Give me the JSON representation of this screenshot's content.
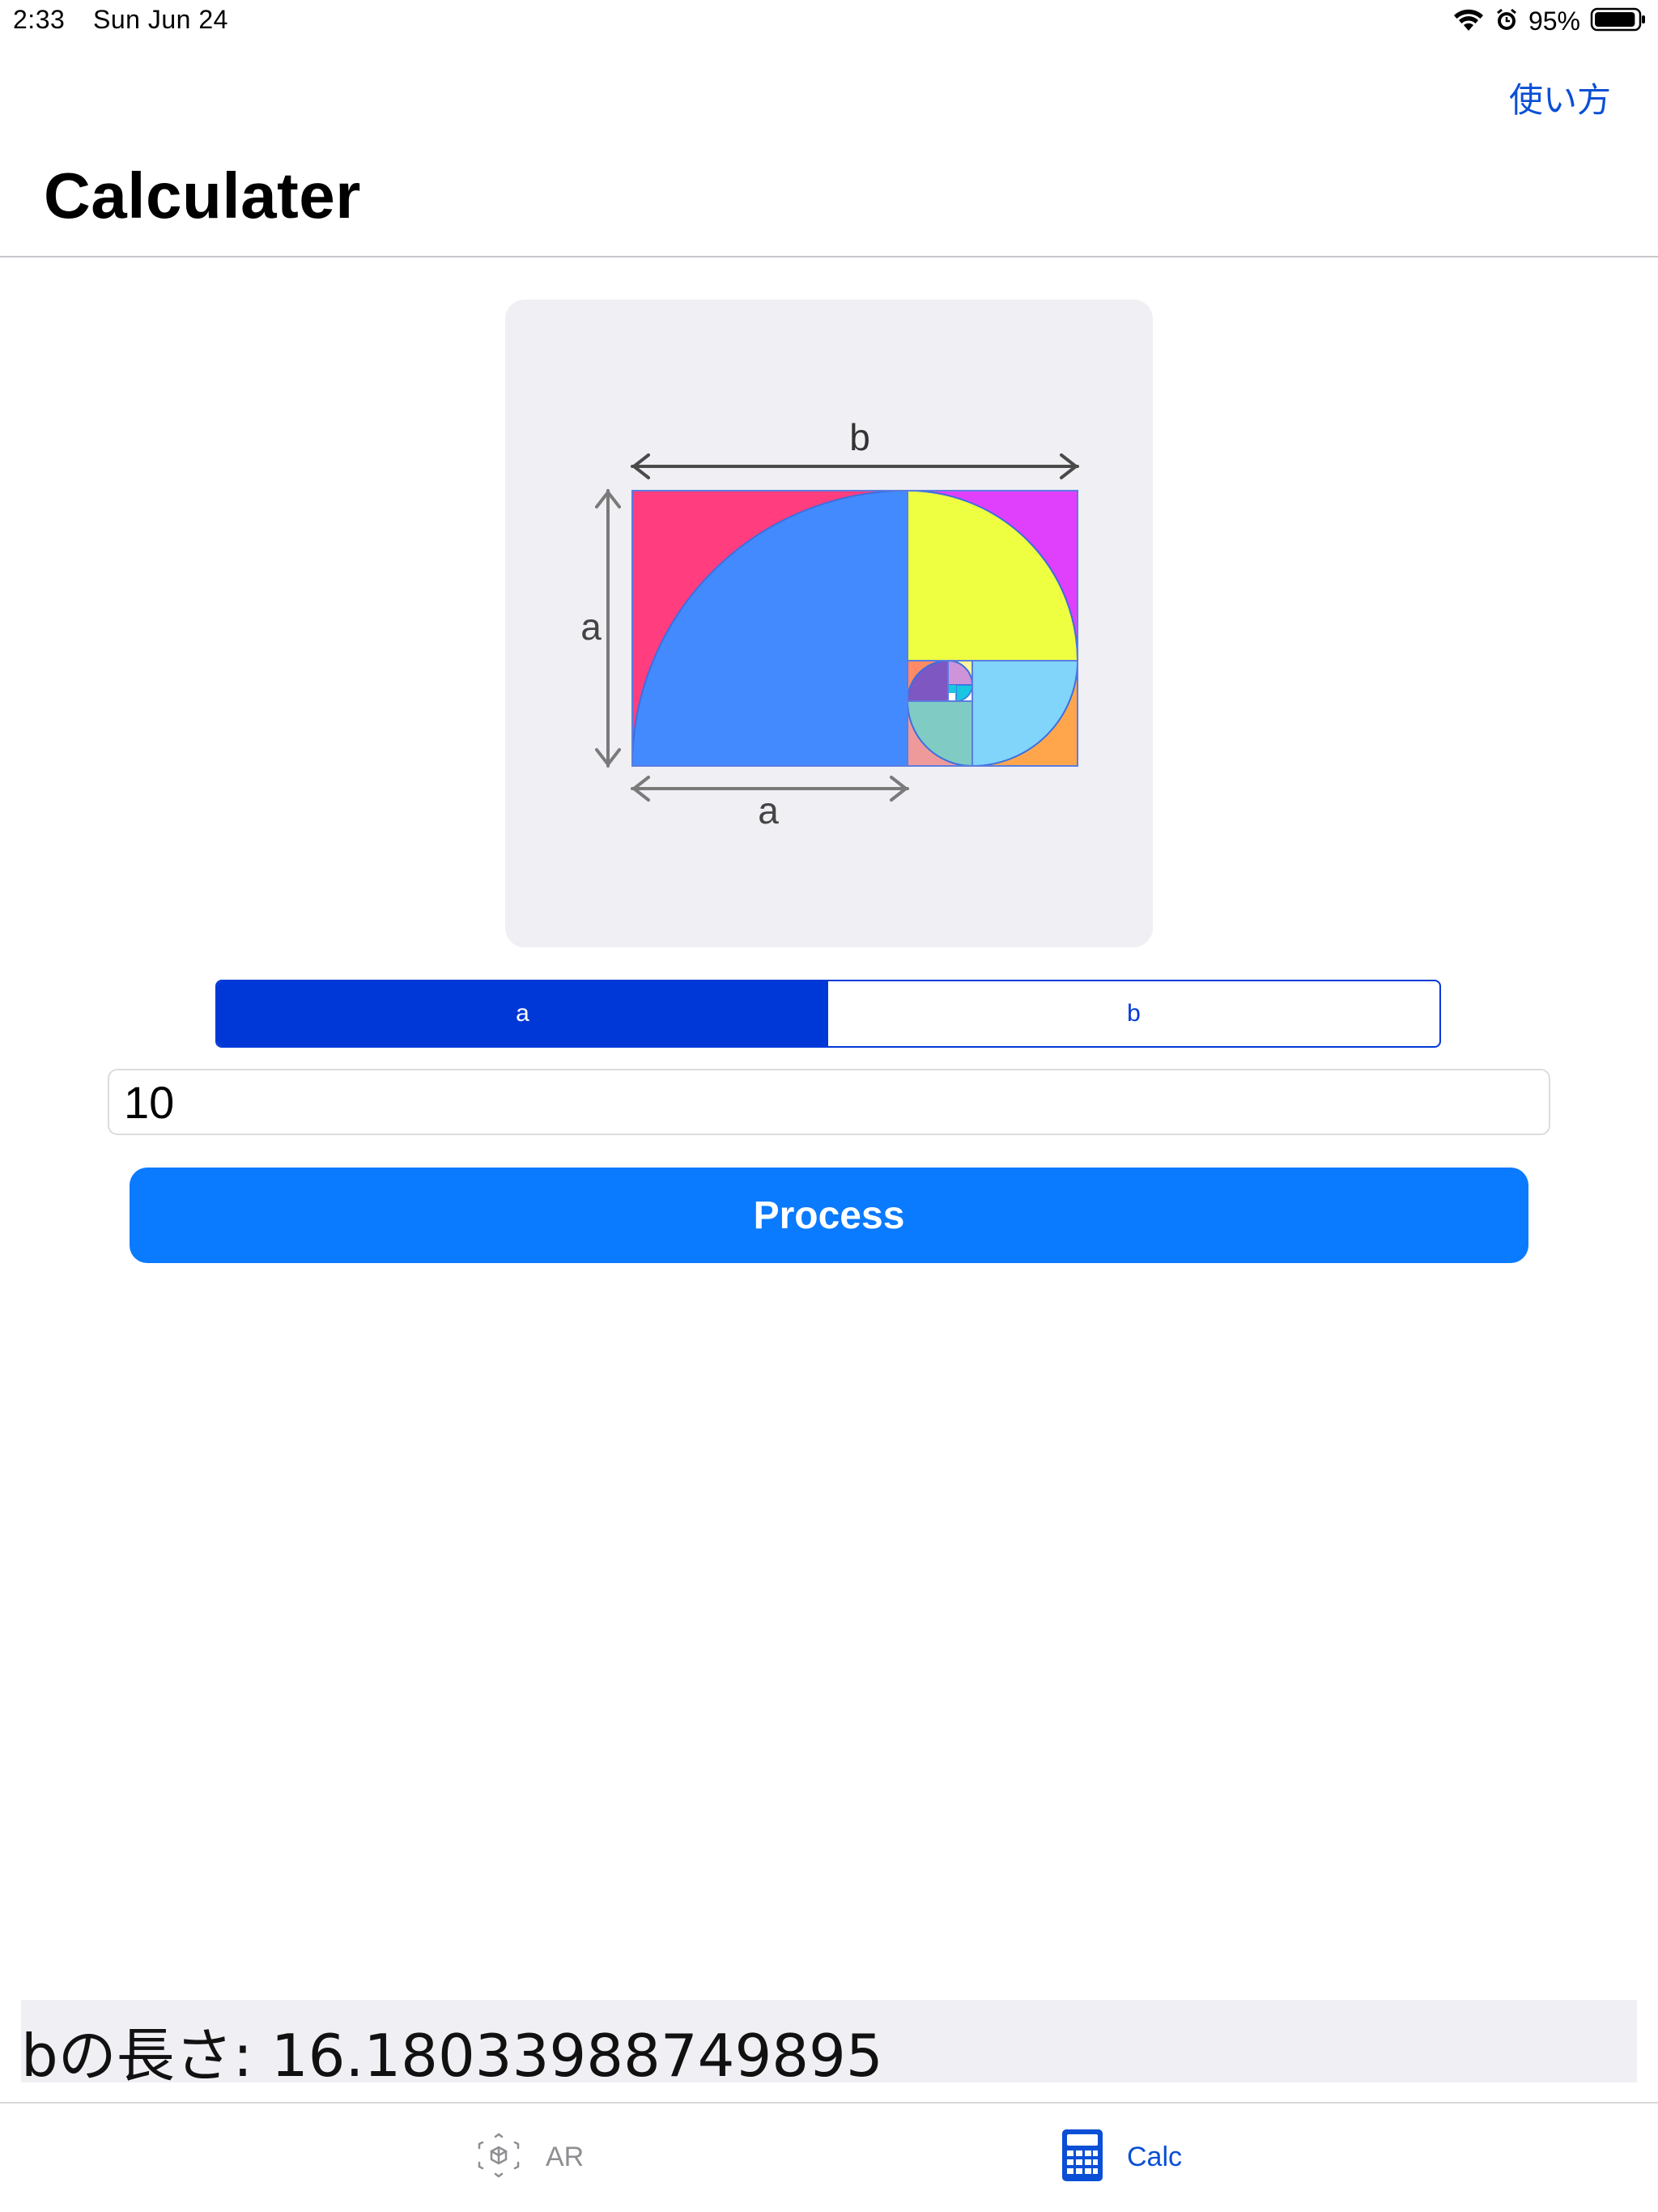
{
  "status_bar": {
    "time": "2:33",
    "date": "Sun Jun 24",
    "battery_percent": "95%",
    "battery_level": 0.95,
    "icons": [
      "wifi-icon",
      "alarm-icon",
      "battery-icon"
    ]
  },
  "nav": {
    "help_label": "使い方",
    "title": "Calculater"
  },
  "diagram": {
    "label_b": "b",
    "label_a_side": "a",
    "label_a_bottom": "a"
  },
  "segmented": {
    "options": [
      "a",
      "b"
    ],
    "selected_index": 0
  },
  "input": {
    "value": "10"
  },
  "process_button": {
    "label": "Process"
  },
  "result": {
    "text": "bの長さ: 16.18033988749895"
  },
  "tab_bar": {
    "items": [
      {
        "label": "AR",
        "icon": "ar-cube-icon",
        "selected": false
      },
      {
        "label": "Calc",
        "icon": "calculator-icon",
        "selected": true
      }
    ]
  },
  "colors": {
    "accent": "#0a7aff",
    "segment_blue": "#0038d8",
    "link_blue": "#0b4fd6",
    "card_bg": "#efeff4"
  }
}
